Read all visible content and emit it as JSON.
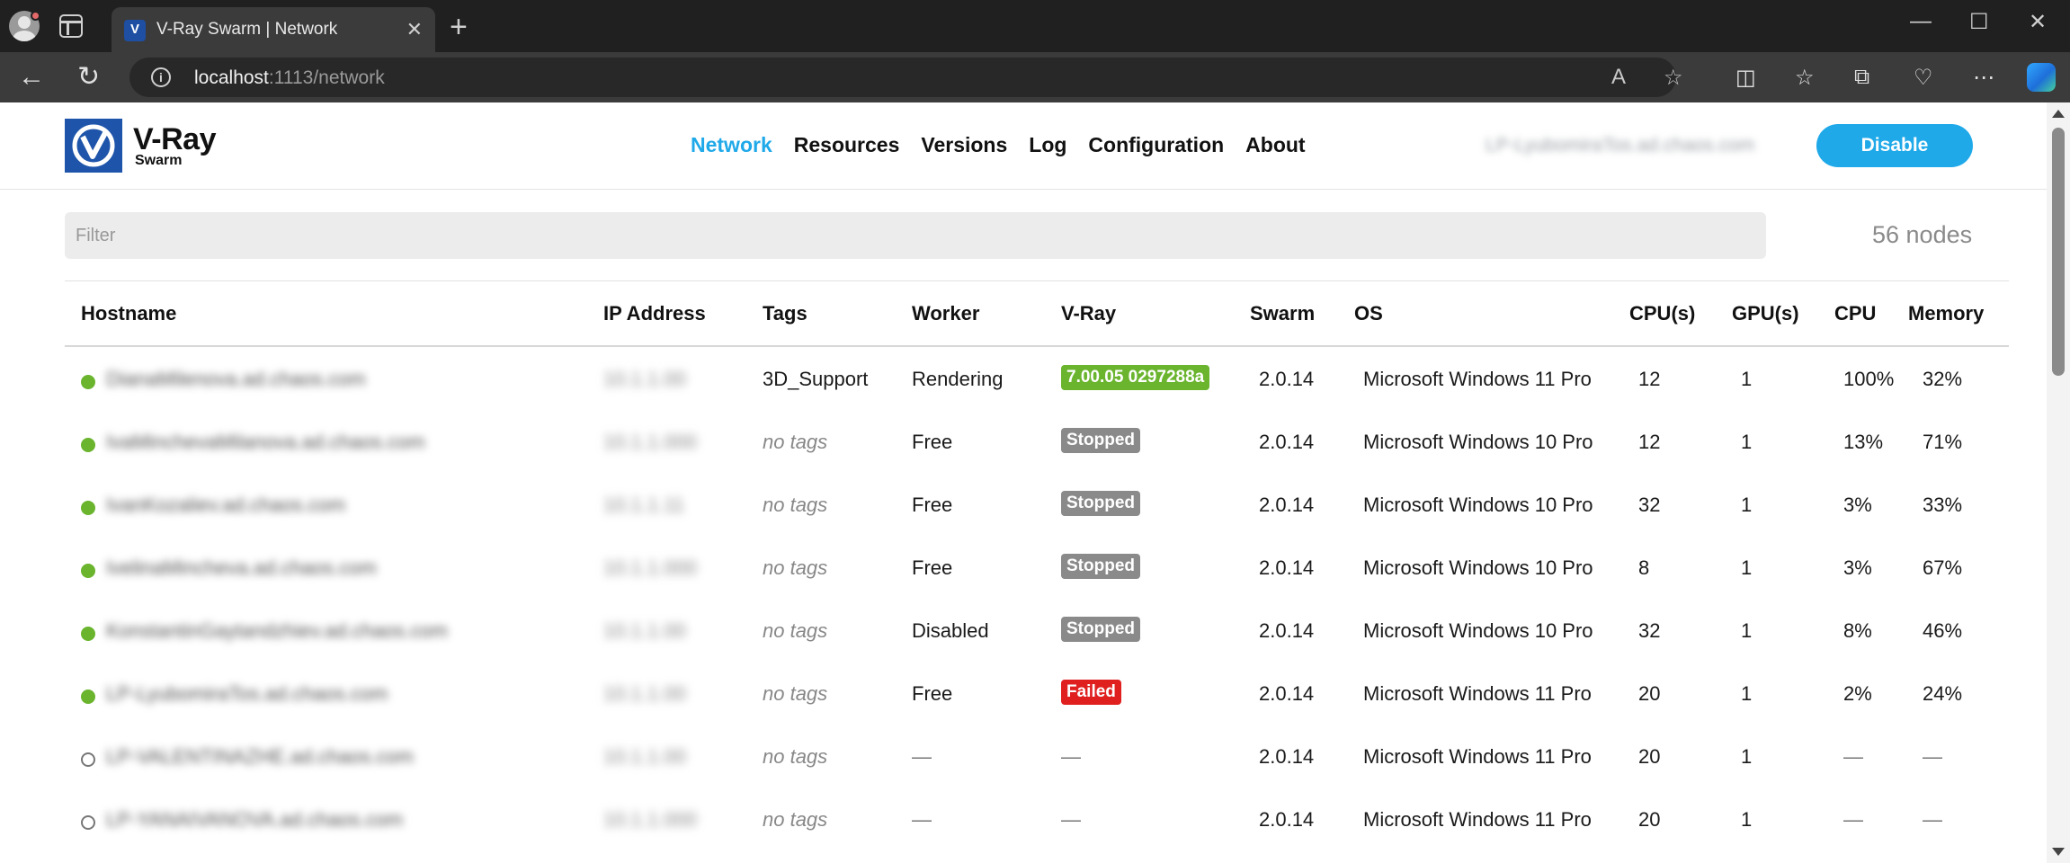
{
  "browser": {
    "tab_title": "V-Ray Swarm | Network",
    "url_host": "localhost",
    "url_rest": ":1113/network"
  },
  "app": {
    "logo_name": "V-Ray",
    "logo_sub": "Swarm",
    "nav": [
      "Network",
      "Resources",
      "Versions",
      "Log",
      "Configuration",
      "About"
    ],
    "active_nav": "Network",
    "host": "LP-LyubomiraTos.ad.chaos.com",
    "disable_label": "Disable",
    "filter_placeholder": "Filter",
    "node_count": "56 nodes",
    "accent_color": "#1fa9e9"
  },
  "table": {
    "columns": [
      "Hostname",
      "IP Address",
      "Tags",
      "Worker",
      "V-Ray",
      "Swarm",
      "OS",
      "CPU(s)",
      "GPU(s)",
      "CPU",
      "Memory"
    ],
    "rows": [
      {
        "online": true,
        "hostname": "DianaMilenova.ad.chaos.com",
        "ip": "10.1.1.00",
        "tags": "3D_Support",
        "worker": "Rendering",
        "vray": "7.00.05 0297288a",
        "vray_status": "green",
        "swarm": "2.0.14",
        "os": "Microsoft Windows 11 Pro",
        "cpus": "12",
        "gpus": "1",
        "cpu": "100%",
        "memory": "32%"
      },
      {
        "online": true,
        "hostname": "IvaMinchevaMilanova.ad.chaos.com",
        "ip": "10.1.1.000",
        "tags": "no tags",
        "worker": "Free",
        "vray": "Stopped",
        "vray_status": "gray",
        "swarm": "2.0.14",
        "os": "Microsoft Windows 10 Pro",
        "cpus": "12",
        "gpus": "1",
        "cpu": "13%",
        "memory": "71%"
      },
      {
        "online": true,
        "hostname": "IvanKozaliev.ad.chaos.com",
        "ip": "10.1.1.11",
        "tags": "no tags",
        "worker": "Free",
        "vray": "Stopped",
        "vray_status": "gray",
        "swarm": "2.0.14",
        "os": "Microsoft Windows 10 Pro",
        "cpus": "32",
        "gpus": "1",
        "cpu": "3%",
        "memory": "33%"
      },
      {
        "online": true,
        "hostname": "IvelinaMincheva.ad.chaos.com",
        "ip": "10.1.1.000",
        "tags": "no tags",
        "worker": "Free",
        "vray": "Stopped",
        "vray_status": "gray",
        "swarm": "2.0.14",
        "os": "Microsoft Windows 10 Pro",
        "cpus": "8",
        "gpus": "1",
        "cpu": "3%",
        "memory": "67%"
      },
      {
        "online": true,
        "hostname": "KonstantinGaytandzhiev.ad.chaos.com",
        "ip": "10.1.1.00",
        "tags": "no tags",
        "worker": "Disabled",
        "vray": "Stopped",
        "vray_status": "gray",
        "swarm": "2.0.14",
        "os": "Microsoft Windows 10 Pro",
        "cpus": "32",
        "gpus": "1",
        "cpu": "8%",
        "memory": "46%"
      },
      {
        "online": true,
        "hostname": "LP-LyubomiraTos.ad.chaos.com",
        "ip": "10.1.1.00",
        "tags": "no tags",
        "worker": "Free",
        "vray": "Failed",
        "vray_status": "red",
        "swarm": "2.0.14",
        "os": "Microsoft Windows 11 Pro",
        "cpus": "20",
        "gpus": "1",
        "cpu": "2%",
        "memory": "24%"
      },
      {
        "online": false,
        "hostname": "LP-VALENTINAZHE.ad.chaos.com",
        "ip": "10.1.1.00",
        "tags": "no tags",
        "worker": "—",
        "vray": "—",
        "vray_status": "none",
        "swarm": "2.0.14",
        "os": "Microsoft Windows 11 Pro",
        "cpus": "20",
        "gpus": "1",
        "cpu": "—",
        "memory": "—"
      },
      {
        "online": false,
        "hostname": "LP-YANAIVANOVA.ad.chaos.com",
        "ip": "10.1.1.000",
        "tags": "no tags",
        "worker": "—",
        "vray": "—",
        "vray_status": "none",
        "swarm": "2.0.14",
        "os": "Microsoft Windows 11 Pro",
        "cpus": "20",
        "gpus": "1",
        "cpu": "—",
        "memory": "—"
      }
    ]
  }
}
